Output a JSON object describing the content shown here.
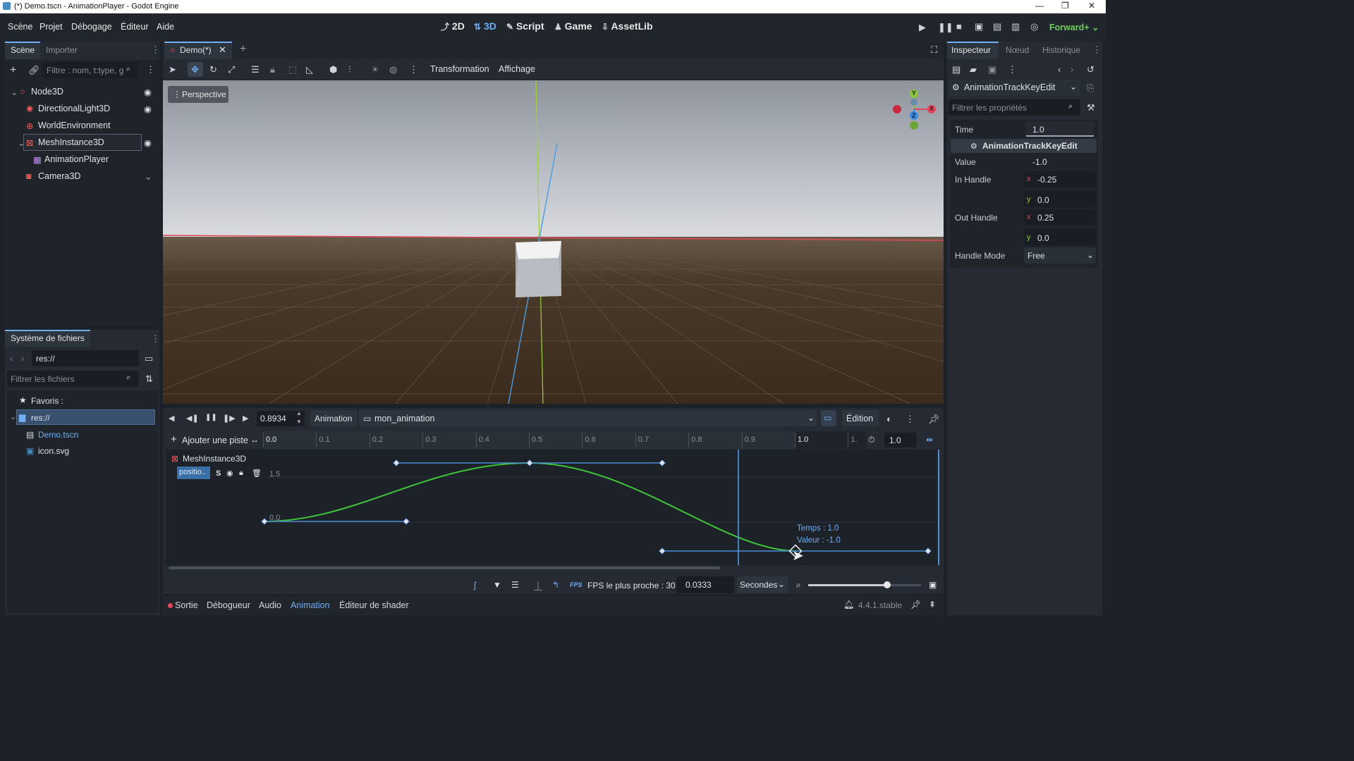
{
  "window": {
    "title": "(*) Demo.tscn - AnimationPlayer - Godot Engine"
  },
  "menu": [
    "Scène",
    "Projet",
    "Débogage",
    "Éditeur",
    "Aide"
  ],
  "workspaces": {
    "w2d": "2D",
    "w3d": "3D",
    "script": "Script",
    "game": "Game",
    "assetlib": "AssetLib"
  },
  "renderer": "Forward+",
  "scene_dock": {
    "tabs": [
      "Scène",
      "Importer"
    ],
    "filter_placeholder": "Filtre : nom, t:type, g",
    "nodes": [
      "Node3D",
      "DirectionalLight3D",
      "WorldEnvironment",
      "MeshInstance3D",
      "AnimationPlayer",
      "Camera3D"
    ]
  },
  "filesystem": {
    "tab": "Système de fichiers",
    "path": "res://",
    "filter_placeholder": "Filtrer les fichiers",
    "favorites": "Favoris :",
    "root": "res://",
    "files": [
      "Demo.tscn",
      "icon.svg"
    ]
  },
  "editor_tabs": {
    "active": "Demo(*)"
  },
  "viewport_toolbar": {
    "transform": "Transformation",
    "view": "Affichage"
  },
  "viewport": {
    "perspective": "Perspective",
    "gizmo": {
      "x": "X",
      "y": "Y",
      "z": "Z"
    }
  },
  "animation": {
    "time": "0.8934",
    "animation_label": "Animation",
    "animation_name": "mon_animation",
    "edit_label": "Édition",
    "add_track": "Ajouter une piste",
    "ruler": [
      "0.0",
      "0.1",
      "0.2",
      "0.3",
      "0.4",
      "0.5",
      "0.6",
      "0.7",
      "0.8",
      "0.9",
      "1.0",
      "1."
    ],
    "length": "1.0",
    "track_node": "MeshInstance3D",
    "track_prop": "positio..",
    "track_s": "S",
    "y_labels": [
      "1.5",
      "0.0"
    ],
    "tooltip_time": "Temps : 1.0",
    "tooltip_value": "Valeur : -1.0",
    "fps_label": "FPS le plus proche : 30",
    "step": "0.0333",
    "step_unit": "Secondes",
    "fps_badge": "FPS",
    "zoom": 0.7
  },
  "inspector": {
    "tabs": [
      "Inspecteur",
      "Nœud",
      "Historique"
    ],
    "object": "AnimationTrackKeyEdit",
    "filter_placeholder": "Filtrer les propriétés",
    "time_label": "Time",
    "time_value": "1.0",
    "section": "AnimationTrackKeyEdit",
    "value_label": "Value",
    "value_value": "-1.0",
    "in_handle_label": "In Handle",
    "in_x": "-0.25",
    "in_y": "0.0",
    "out_handle_label": "Out Handle",
    "out_x": "0.25",
    "out_y": "0.0",
    "mode_label": "Handle Mode",
    "mode_value": "Free",
    "x": "x",
    "y": "y"
  },
  "bottom_tabs": [
    "Sortie",
    "Débogueur",
    "Audio",
    "Animation",
    "Éditeur de shader"
  ],
  "version": "4.4.1.stable"
}
